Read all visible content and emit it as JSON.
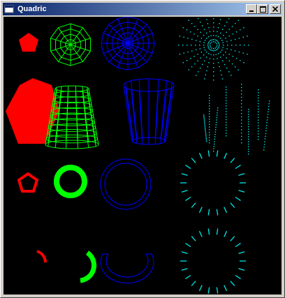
{
  "window": {
    "title": "Quadric",
    "buttons": [
      {
        "name": "minimize-button",
        "icon": "minimize-icon"
      },
      {
        "name": "maximize-button",
        "icon": "maximize-icon"
      },
      {
        "name": "close-button",
        "icon": "close-icon"
      }
    ]
  },
  "canvas": {
    "background": "#000000",
    "colors": {
      "red": "#ff0000",
      "green": "#00ff00",
      "blue": "#0000ff",
      "cyan": "#00e8e8"
    },
    "rows": [
      {
        "shapes": [
          "disk-fill",
          "sphere-wire-green",
          "sphere-wire-blue",
          "sphere-points-cyan"
        ]
      },
      {
        "shapes": [
          "cylinder-fill",
          "cylinder-wire-green",
          "cylinder-wire-blue",
          "cylinder-points-cyan"
        ]
      },
      {
        "shapes": [
          "ring-outline-red",
          "ring-fill-green",
          "ring-wire-blue",
          "ring-dashes-cyan"
        ]
      },
      {
        "shapes": [
          "partial-disk-red",
          "partial-disk-green",
          "partial-disk-blue",
          "partial-disk-cyan"
        ]
      }
    ]
  }
}
